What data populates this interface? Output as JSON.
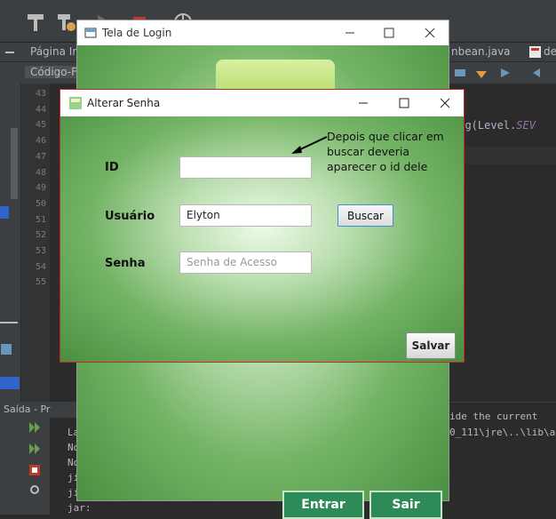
{
  "ide": {
    "tabs": [
      {
        "label": "Página In"
      },
      {
        "label": "nbean.java"
      },
      {
        "label": "de"
      }
    ],
    "subtab": "Código-F",
    "line_numbers": [
      "43",
      "44",
      "45",
      "46",
      "47",
      "48",
      "49",
      "50",
      "51",
      "52",
      "53",
      "54",
      "55"
    ],
    "code_fragment_prefix": "log(Level.",
    "code_fragment_kw": "SEV",
    "bottom_panel_title": "Saída - Pr",
    "output_lines": [
      "La",
      "No",
      "No",
      "ji",
      "ji",
      "jar:"
    ],
    "output_right_1": "ide the current",
    "output_right_2": "0_111\\jre\\..\\lib\\a"
  },
  "login_window": {
    "title": "Tela de Login",
    "enter_label": "Entrar",
    "exit_label": "Sair"
  },
  "dialog": {
    "title": "Alterar Senha",
    "id_label": "ID",
    "id_value": "",
    "user_label": "Usuário",
    "user_value": "Elyton",
    "password_label": "Senha",
    "password_placeholder": "Senha de Acesso",
    "search_label": "Buscar",
    "save_label": "Salvar",
    "annotation": "Depois que clicar em buscar deveria aparecer o id dele"
  },
  "colors": {
    "dialog_border": "#c62828",
    "login_button": "#2e8b57",
    "ide_background": "#2b2b2b"
  }
}
